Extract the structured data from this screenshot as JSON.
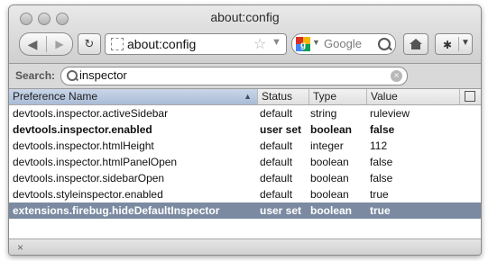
{
  "window": {
    "title": "about:config"
  },
  "toolbar": {
    "url": "about:config",
    "search_engine": "Google"
  },
  "filter": {
    "label": "Search:",
    "value": "inspector"
  },
  "columns": {
    "name": "Preference Name",
    "status": "Status",
    "type": "Type",
    "value": "Value"
  },
  "rows": [
    {
      "name": "devtools.inspector.activeSidebar",
      "status": "default",
      "type": "string",
      "value": "ruleview"
    },
    {
      "name": "devtools.inspector.enabled",
      "status": "user set",
      "type": "boolean",
      "value": "false"
    },
    {
      "name": "devtools.inspector.htmlHeight",
      "status": "default",
      "type": "integer",
      "value": "112"
    },
    {
      "name": "devtools.inspector.htmlPanelOpen",
      "status": "default",
      "type": "boolean",
      "value": "false"
    },
    {
      "name": "devtools.inspector.sidebarOpen",
      "status": "default",
      "type": "boolean",
      "value": "false"
    },
    {
      "name": "devtools.styleinspector.enabled",
      "status": "default",
      "type": "boolean",
      "value": "true"
    },
    {
      "name": "extensions.firebug.hideDefaultInspector",
      "status": "user set",
      "type": "boolean",
      "value": "true"
    }
  ],
  "colors": {
    "selection": "#7b8aa1",
    "sorted_header": "#b6c5dc"
  }
}
